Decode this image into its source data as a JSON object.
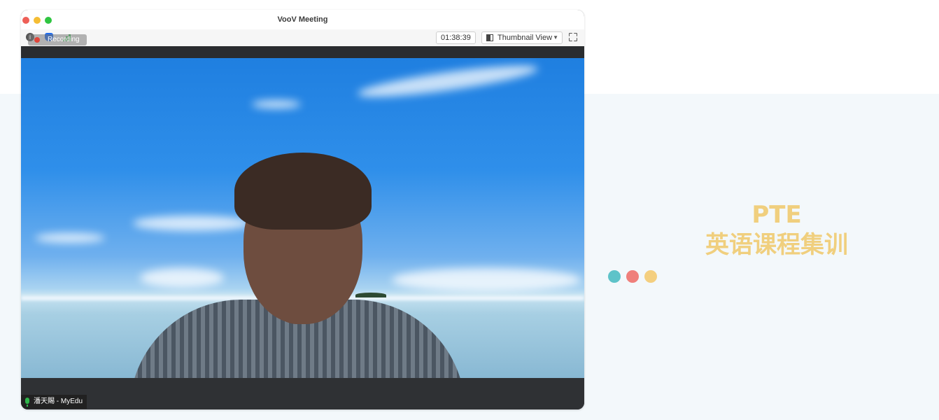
{
  "window": {
    "title": "VooV Meeting",
    "recording_label": "Recording",
    "timer": "01:38:39",
    "view_mode": "Thumbnail View"
  },
  "video": {
    "participant_name": "潘天賜 - MyEdu"
  },
  "side": {
    "title": "PTE",
    "subtitle": "英语课程集训",
    "dot_colors": [
      "#5ec3c9",
      "#ef7f7b",
      "#f4cf7f"
    ]
  },
  "icons": [
    "info-icon",
    "shield-icon",
    "signal-icon",
    "view-layout-icon",
    "chevron-down-icon",
    "fullscreen-icon",
    "microphone-icon"
  ]
}
